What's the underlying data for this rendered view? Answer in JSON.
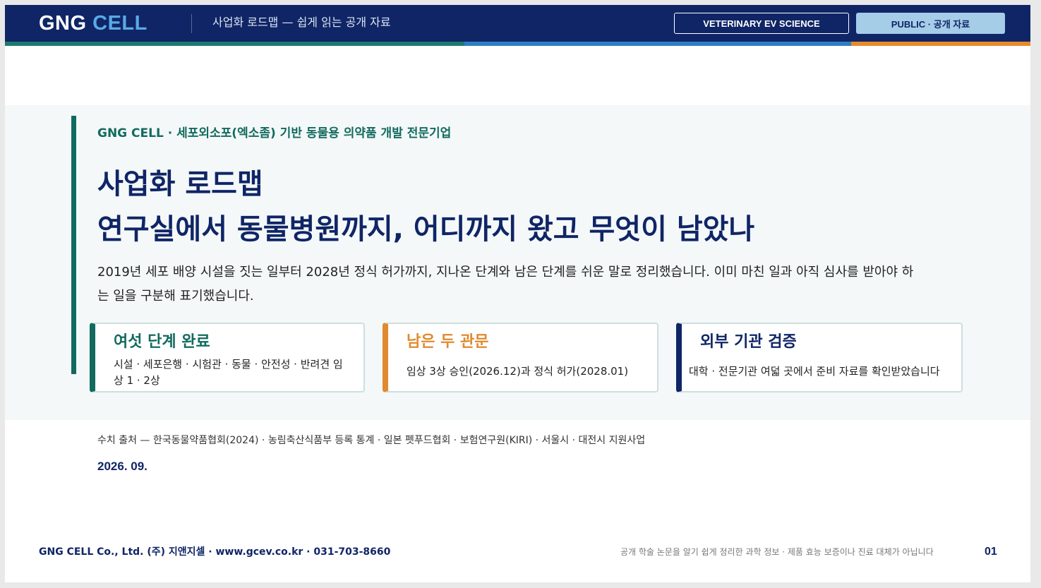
{
  "header": {
    "logo_main": "GNG",
    "logo_accent": "CELL",
    "subtitle": "사업화 로드맵 — 쉽게 읽는 공개 자료",
    "badge_category": "VETERINARY EV SCIENCE",
    "badge_access": "PUBLIC · 공개 자료"
  },
  "colors": {
    "navy": "#0f2566",
    "teal": "#126a5f",
    "blue": "#2e7fc2",
    "orange": "#e08a30",
    "light_blue": "#a6cde8"
  },
  "hero": {
    "eyebrow": "GNG CELL  ·  세포외소포(엑소좀) 기반 동물용 의약품 개발 전문기업",
    "title_line1": "사업화 로드맵",
    "title_line2": "연구실에서 동물병원까지, 어디까지 왔고 무엇이 남았나",
    "lead": "2019년 세포 배양 시설을 짓는 일부터 2028년 정식 허가까지, 지나온 단계와 남은 단계를 쉬운 말로 정리했습니다. 이미 마친 일과 아직 심사를 받아야 하는 일을 구분해 표기했습니다."
  },
  "cards": [
    {
      "title": "여섯 단계 완료",
      "body": "시설 · 세포은행 · 시험관 · 동물 · 안전성 · 반려견 임상 1 · 2상"
    },
    {
      "title": "남은 두 관문",
      "body": "임상 3상 승인(2026.12)과 정식 허가(2028.01)"
    },
    {
      "title": "외부 기관 검증",
      "body": "대학 · 전문기관 여덟 곳에서 준비 자료를 확인받았습니다"
    }
  ],
  "source": "수치 출처 — 한국동물약품협회(2024) · 농림축산식품부 등록 통계 · 일본 펫푸드협회 · 보험연구원(KIRI) · 서울시 · 대전시 지원사업",
  "date": "2026. 09.",
  "footer": {
    "company": "GNG CELL Co., Ltd. (주) 지앤지셀 · www.gcev.co.kr · 031-703-8660",
    "disclaimer": "공개 학술 논문을 알기 쉽게 정리한 과학 정보 · 제품 효능 보증이나 진료 대체가 아닙니다",
    "page": "01"
  }
}
